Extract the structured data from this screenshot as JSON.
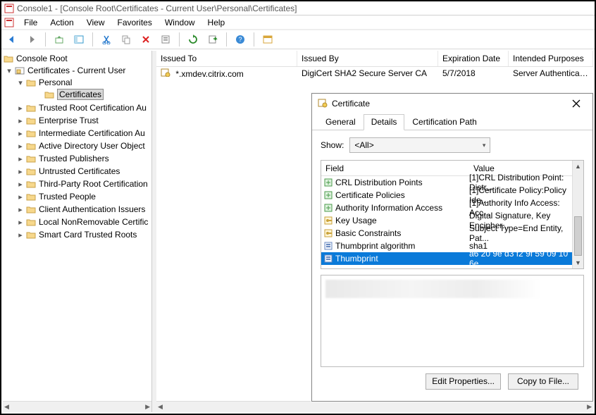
{
  "window": {
    "title": "Console1 - [Console Root\\Certificates - Current User\\Personal\\Certificates]"
  },
  "menu": {
    "file": "File",
    "action": "Action",
    "view": "View",
    "favorites": "Favorites",
    "window": "Window",
    "help": "Help"
  },
  "tree": {
    "root": "Console Root",
    "certs": "Certificates - Current User",
    "personal": "Personal",
    "certificates": "Certificates",
    "items": [
      "Trusted Root Certification Au",
      "Enterprise Trust",
      "Intermediate Certification Au",
      "Active Directory User Object",
      "Trusted Publishers",
      "Untrusted Certificates",
      "Third-Party Root Certification",
      "Trusted People",
      "Client Authentication Issuers",
      "Local NonRemovable Certific",
      "Smart Card Trusted Roots"
    ]
  },
  "list": {
    "cols": {
      "issued_to": "Issued To",
      "issued_by": "Issued By",
      "expiration": "Expiration Date",
      "purposes": "Intended Purposes"
    },
    "row": {
      "issued_to": "*.xmdev.citrix.com",
      "issued_by": "DigiCert SHA2 Secure Server CA",
      "expiration": "5/7/2018",
      "purposes": "Server Authenticati..."
    }
  },
  "dialog": {
    "title": "Certificate",
    "tabs": {
      "general": "General",
      "details": "Details",
      "certpath": "Certification Path"
    },
    "show_label": "Show:",
    "show_value": "<All>",
    "field_header": "Field",
    "value_header": "Value",
    "fields": [
      {
        "name": "CRL Distribution Points",
        "value": "[1]CRL Distribution Point: Distr...",
        "icon": "ext"
      },
      {
        "name": "Certificate Policies",
        "value": "[1]Certificate Policy:Policy Ide...",
        "icon": "ext"
      },
      {
        "name": "Authority Information Access",
        "value": "[1]Authority Info Access: Acc...",
        "icon": "ext"
      },
      {
        "name": "Key Usage",
        "value": "Digital Signature, Key Encipher...",
        "icon": "key"
      },
      {
        "name": "Basic Constraints",
        "value": "Subject Type=End Entity, Pat...",
        "icon": "key"
      },
      {
        "name": "Thumbprint algorithm",
        "value": "sha1",
        "icon": "prop"
      },
      {
        "name": "Thumbprint",
        "value": "a6 20 9e d3 f2 9f 59 09 10 6e ...",
        "icon": "prop"
      }
    ],
    "selected_index": 6,
    "btn_edit": "Edit Properties...",
    "btn_copy": "Copy to File..."
  }
}
